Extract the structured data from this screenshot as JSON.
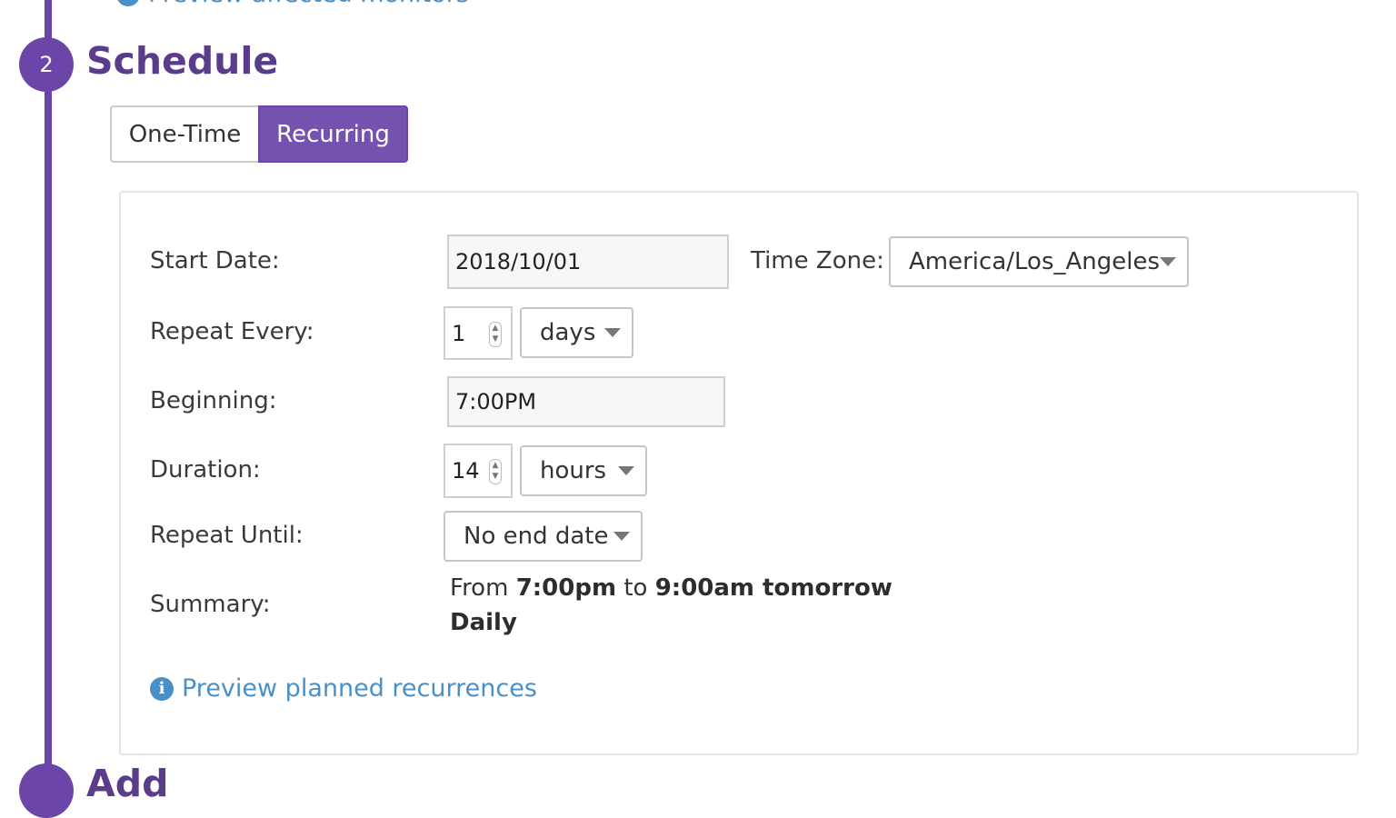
{
  "top_link": {
    "label": "Preview affected monitors"
  },
  "step2": {
    "number": "2",
    "title": "Schedule"
  },
  "step3": {
    "number": "",
    "title": "Add"
  },
  "schedule_type": {
    "one_time": "One-Time",
    "recurring": "Recurring",
    "selected": "Recurring"
  },
  "form": {
    "start_date": {
      "label": "Start Date:",
      "value": "2018/10/01"
    },
    "time_zone": {
      "label": "Time Zone:",
      "value": "America/Los_Angeles"
    },
    "repeat_every": {
      "label": "Repeat Every:",
      "value": "1",
      "unit": "days"
    },
    "beginning": {
      "label": "Beginning:",
      "value": "7:00PM"
    },
    "duration": {
      "label": "Duration:",
      "value": "14",
      "unit": "hours"
    },
    "repeat_until": {
      "label": "Repeat Until:",
      "value": "No end date"
    },
    "summary": {
      "label": "Summary:",
      "from": "From",
      "start": "7:00pm",
      "to": "to",
      "end": "9:00am tomorrow",
      "frequency": "Daily"
    }
  },
  "preview_link": {
    "label": "Preview planned recurrences"
  },
  "icons": {
    "info": "info-icon",
    "caret": "caret-down-icon",
    "spinner": "number-spinner-icon"
  },
  "colors": {
    "accent": "#6b46a8",
    "link": "#4a90c8"
  }
}
